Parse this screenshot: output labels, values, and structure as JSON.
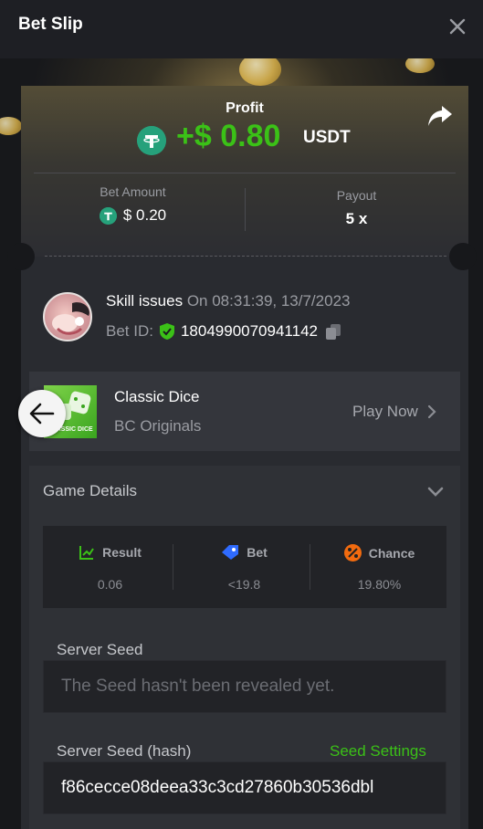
{
  "header": {
    "title": "Bet Slip"
  },
  "profit": {
    "label": "Profit",
    "amount": "+$ 0.80",
    "currency": "USDT"
  },
  "bet_amount": {
    "label": "Bet Amount",
    "value": "$ 0.20"
  },
  "payout": {
    "label": "Payout",
    "value": "5 x"
  },
  "user": {
    "name": "Skill issues",
    "time": "On 08:31:39, 13/7/2023",
    "bet_id_label": "Bet ID:",
    "bet_id": "1804990070941142"
  },
  "game": {
    "name": "Classic Dice",
    "provider": "BC Originals",
    "play_label": "Play Now",
    "thumb_text": "CLASSIC DICE"
  },
  "details": {
    "title": "Game Details",
    "stats": [
      {
        "label": "Result",
        "value": "0.06"
      },
      {
        "label": "Bet",
        "value": "<19.8"
      },
      {
        "label": "Chance",
        "value": "19.80%"
      }
    ],
    "server_seed_label": "Server Seed",
    "server_seed_value": "The Seed hasn't been revealed yet.",
    "server_seed_hash_label": "Server Seed (hash)",
    "seed_settings_label": "Seed Settings",
    "server_seed_hash_value": "f86cecce08deea33c3cd27860b30536dbl"
  },
  "colors": {
    "accent_green": "#3bc117",
    "tether": "#26a17b",
    "bg": "#17181b"
  }
}
